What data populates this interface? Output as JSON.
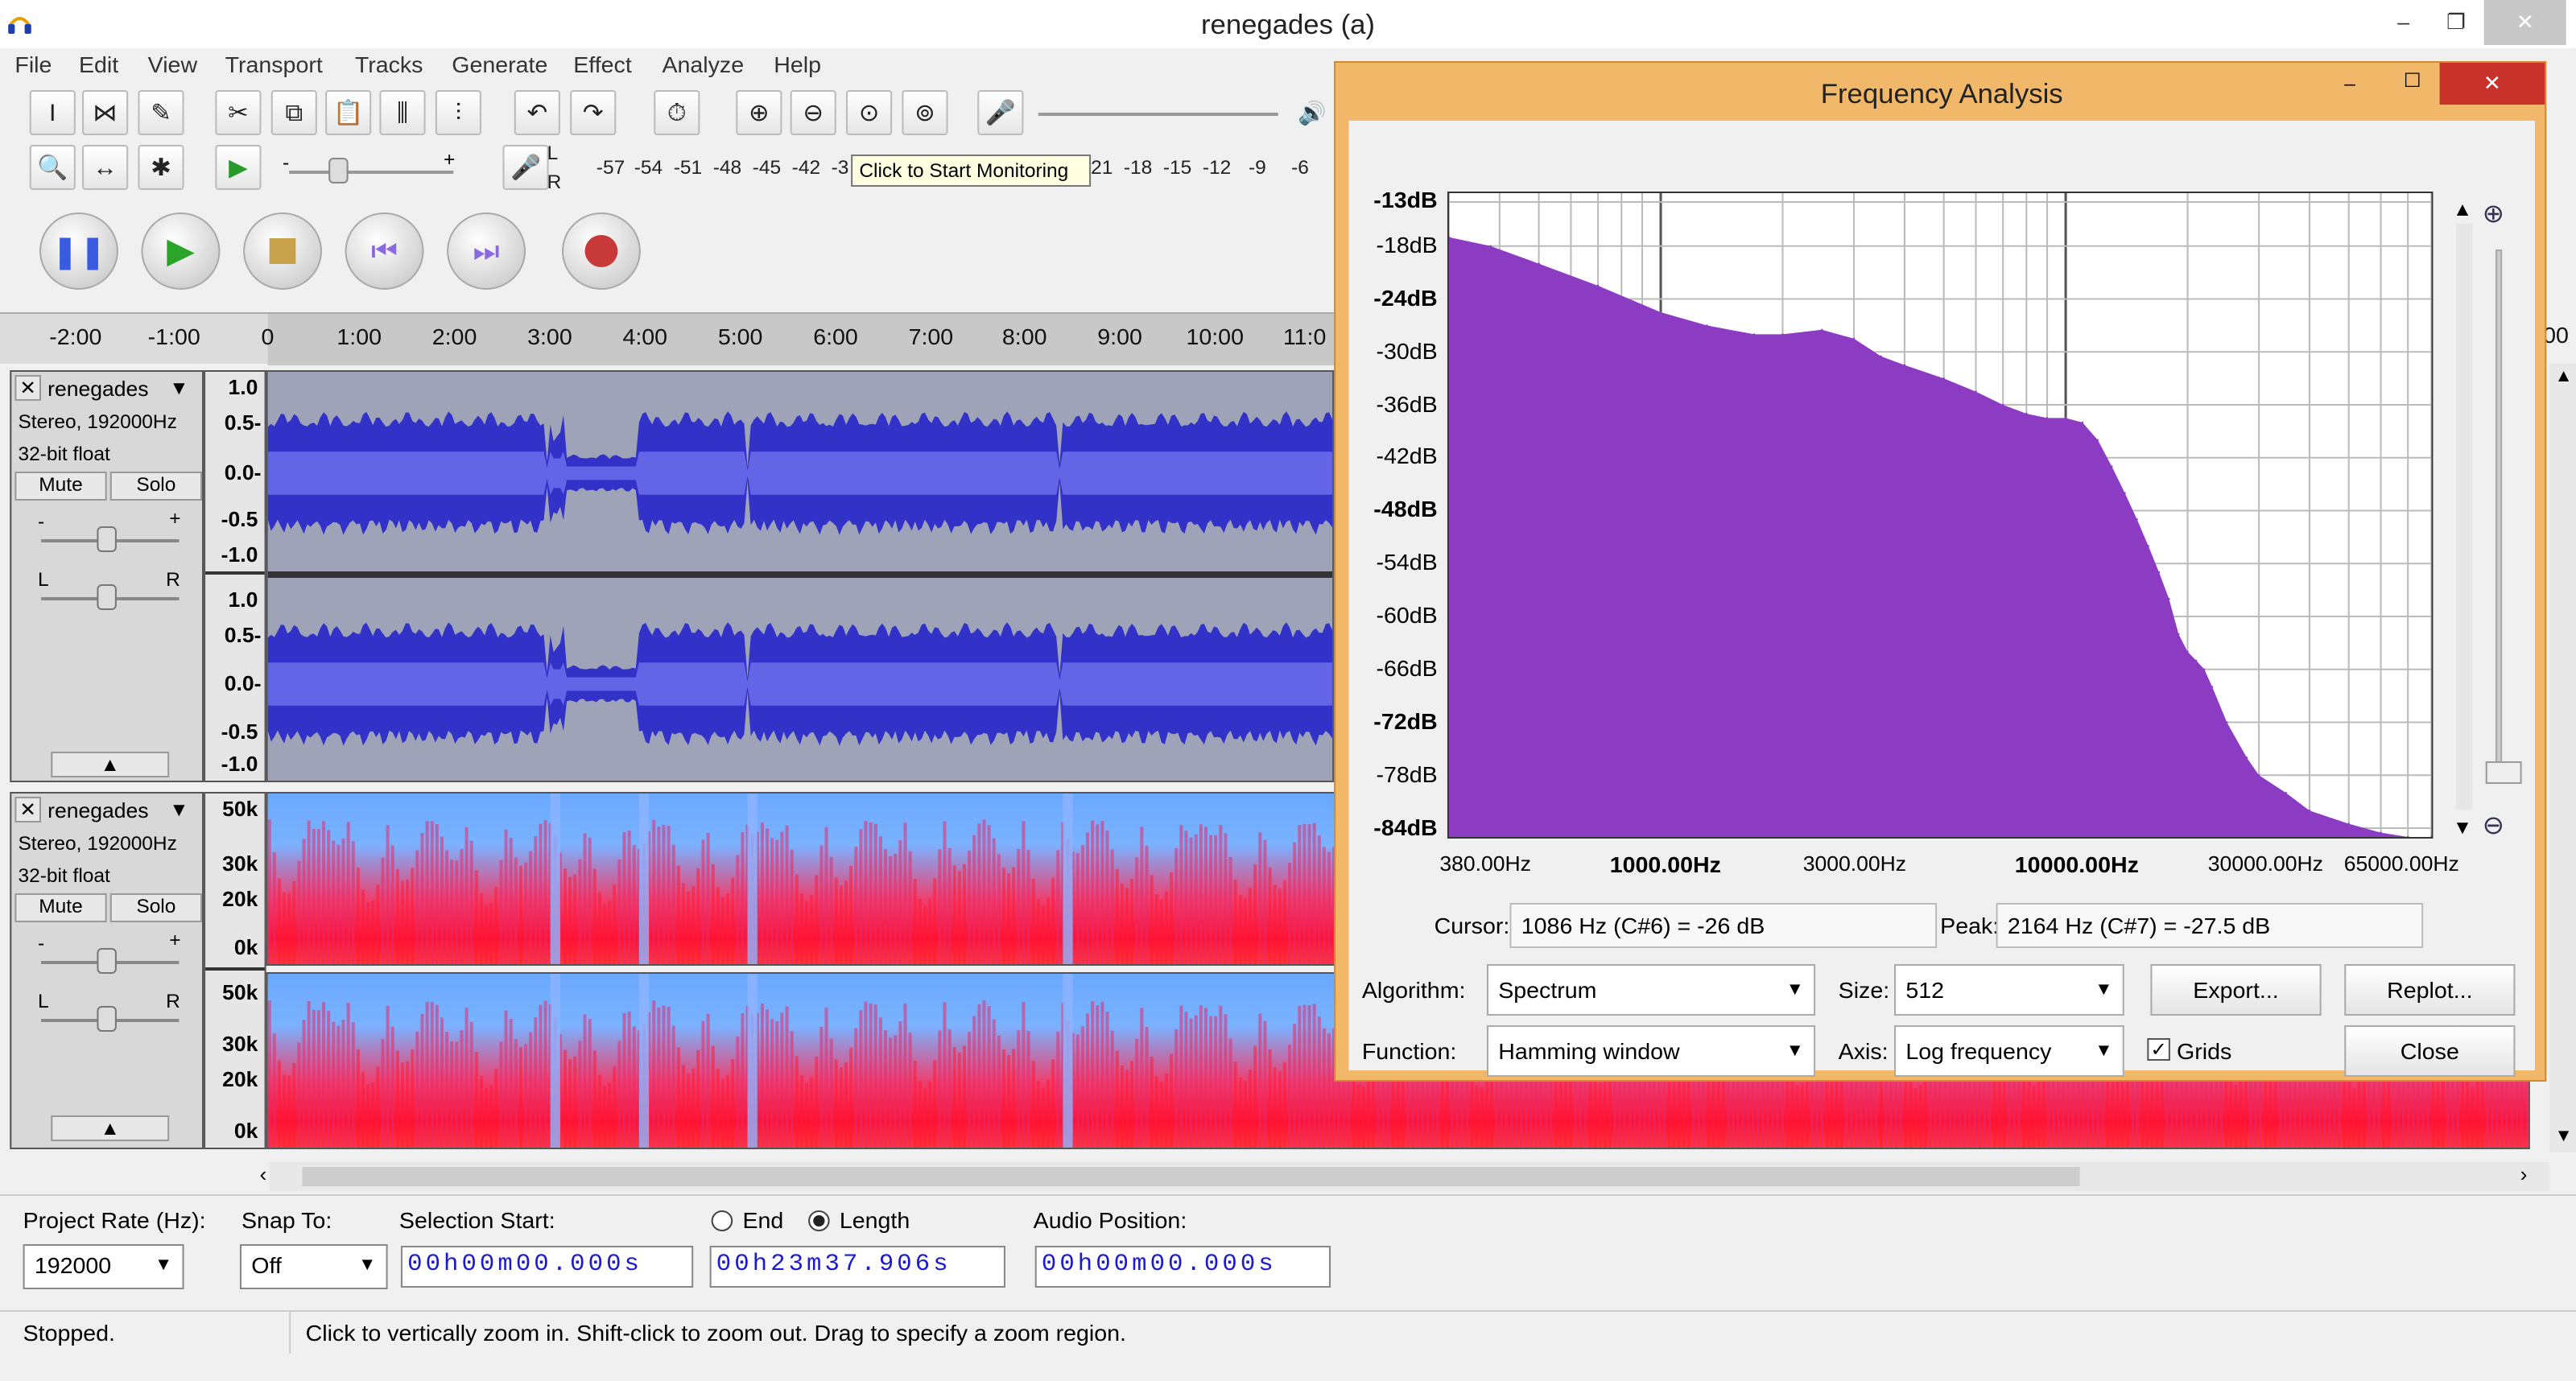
{
  "window": {
    "title": "renegades (a)",
    "minimize": "‒",
    "restore": "❐",
    "close": "✕"
  },
  "menu": [
    "File",
    "Edit",
    "View",
    "Transport",
    "Tracks",
    "Generate",
    "Effect",
    "Analyze",
    "Help"
  ],
  "meter": {
    "recording_scale": [
      "-57",
      "-54",
      "-51",
      "-48",
      "-45",
      "-42",
      "-3"
    ],
    "tooltip": "Click to Start Monitoring",
    "playback_scale": [
      "21",
      "-18",
      "-15",
      "-12",
      "-9",
      "-6"
    ],
    "left_label": "L",
    "right_label": "R"
  },
  "ruler": {
    "labels": [
      "-2:00",
      "-1:00",
      "0",
      "1:00",
      "2:00",
      "3:00",
      "4:00",
      "5:00",
      "6:00",
      "7:00",
      "8:00",
      "9:00",
      "10:00",
      "11:0"
    ],
    "right_fragment": "00"
  },
  "tracks": [
    {
      "name": "renegades",
      "info1": "Stereo, 192000Hz",
      "info2": "32-bit float",
      "mute": "Mute",
      "solo": "Solo",
      "pan_left": "L",
      "pan_right": "R",
      "gain_minus": "-",
      "gain_plus": "+",
      "scale_top": [
        "1.0",
        "0.5-",
        "0.0-",
        "-0.5",
        "-1.0"
      ],
      "scale_bottom": [
        "1.0",
        "0.5-",
        "0.0-",
        "-0.5",
        "-1.0"
      ]
    },
    {
      "name": "renegades",
      "info1": "Stereo, 192000Hz",
      "info2": "32-bit float",
      "mute": "Mute",
      "solo": "Solo",
      "pan_left": "L",
      "pan_right": "R",
      "gain_minus": "-",
      "gain_plus": "+",
      "scale_top": [
        "50k",
        "30k",
        "20k",
        "0k"
      ],
      "scale_bottom": [
        "50k",
        "30k",
        "20k",
        "0k"
      ]
    }
  ],
  "bottom": {
    "project_rate_label": "Project Rate (Hz):",
    "project_rate": "192000",
    "snap_label": "Snap To:",
    "snap_value": "Off",
    "selection_start_label": "Selection Start:",
    "selection_start": "00h00m00.000s",
    "end_label": "End",
    "length_label": "Length",
    "length_value": "00h23m37.906s",
    "audio_position_label": "Audio Position:",
    "audio_position": "00h00m00.000s"
  },
  "status": {
    "state": "Stopped.",
    "hint": "Click to vertically zoom in. Shift-click to zoom out. Drag to specify a zoom region."
  },
  "dialog": {
    "title": "Frequency Analysis",
    "cursor_label": "Cursor:",
    "cursor_value": "1086 Hz (C#6) = -26 dB",
    "peak_label": "Peak:",
    "peak_value": "2164 Hz (C#7) = -27.5 dB",
    "algorithm_label": "Algorithm:",
    "algorithm_value": "Spectrum",
    "size_label": "Size:",
    "size_value": "512",
    "export_label": "Export...",
    "replot_label": "Replot...",
    "function_label": "Function:",
    "function_value": "Hamming window",
    "axis_label": "Axis:",
    "axis_value": "Log frequency",
    "grids_label": "Grids",
    "grids_checked": true,
    "close_label": "Close"
  },
  "chart_data": {
    "type": "area",
    "xscale": "log",
    "xlim": [
      300,
      80000
    ],
    "ylim": [
      -85,
      -12
    ],
    "y_ticks": [
      "-13dB",
      "-18dB",
      "-24dB",
      "-30dB",
      "-36dB",
      "-42dB",
      "-48dB",
      "-54dB",
      "-60dB",
      "-66dB",
      "-72dB",
      "-78dB",
      "-84dB"
    ],
    "y_tick_values": [
      -13,
      -18,
      -24,
      -30,
      -36,
      -42,
      -48,
      -54,
      -60,
      -66,
      -72,
      -78,
      -84
    ],
    "x_ticks": [
      "380.00Hz",
      "1000.00Hz",
      "3000.00Hz",
      "10000.00Hz",
      "30000.00Hz",
      "65000.00Hz"
    ],
    "x_tick_values": [
      380,
      1000,
      3000,
      10000,
      30000,
      65000
    ],
    "x_bold_ticks": [
      "1000.00Hz",
      "10000.00Hz"
    ],
    "grid": true,
    "color": "#8c3cc2",
    "x": [
      300,
      380,
      500,
      700,
      1000,
      1300,
      1700,
      2000,
      2500,
      3000,
      3500,
      4000,
      5000,
      6000,
      7000,
      8000,
      9000,
      10000,
      11000,
      12000,
      13000,
      14000,
      15000,
      16000,
      17000,
      18000,
      19000,
      20000,
      21000,
      22000,
      23000,
      25000,
      28000,
      30000,
      35000,
      40000,
      50000,
      60000,
      70000,
      80000
    ],
    "y": [
      -17,
      -18,
      -20,
      -22.5,
      -25.5,
      -27,
      -28,
      -28,
      -27.5,
      -28.5,
      -30.5,
      -31.5,
      -33,
      -34.5,
      -36,
      -37,
      -37.5,
      -37.5,
      -38,
      -40,
      -43,
      -46,
      -49,
      -52,
      -55,
      -58,
      -62,
      -64,
      -65,
      -66,
      -68,
      -72,
      -76,
      -78,
      -80,
      -82,
      -83.5,
      -84.5,
      -85,
      -85
    ]
  }
}
